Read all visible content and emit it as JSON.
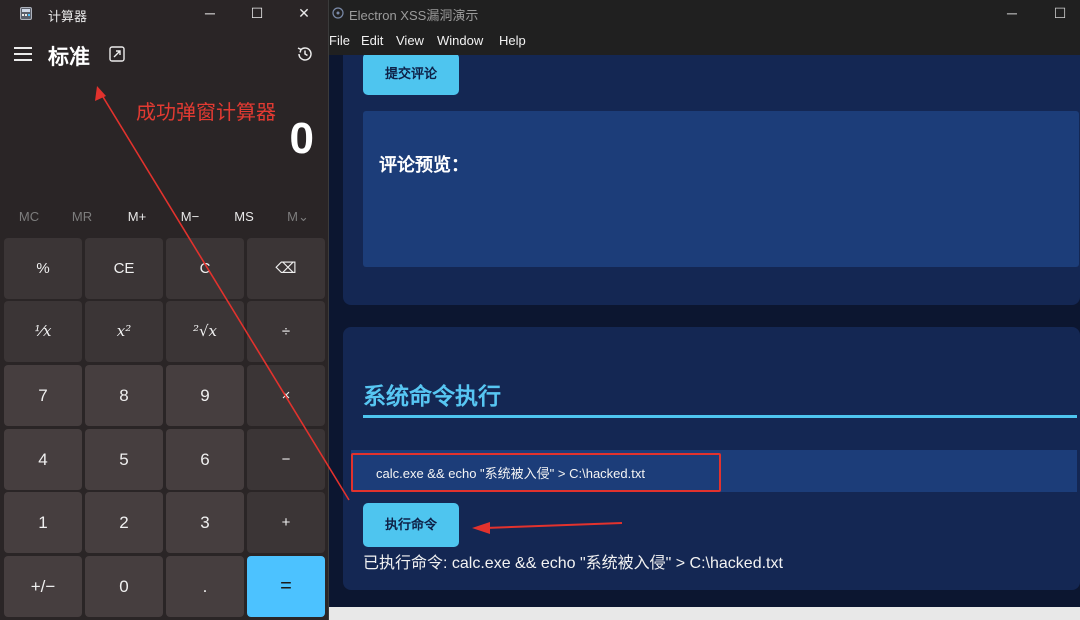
{
  "electron": {
    "title": "Electron XSS漏洞演示",
    "window_controls": {
      "minimize": "─",
      "maximize": "☐"
    },
    "menu": [
      "File",
      "Edit",
      "View",
      "Window",
      "Help"
    ],
    "comment_section": {
      "submit_label": "提交评论",
      "preview_title": "评论预览："
    },
    "command_section": {
      "heading": "系统命令执行",
      "input_value": "calc.exe && echo \"系统被入侵\" > C:\\hacked.txt",
      "execute_label": "执行命令",
      "result_text": "已执行命令: calc.exe && echo \"系统被入侵\" > C:\\hacked.txt"
    },
    "colors": {
      "accent": "#4ec5ef",
      "panel": "#142753",
      "input_bg": "#1c3d79",
      "background": "#0c1630"
    }
  },
  "calculator": {
    "title": "计算器",
    "window_controls": {
      "minimize": "─",
      "maximize": "☐",
      "close": "✕"
    },
    "mode": "标准",
    "display": "0",
    "memory": [
      "MC",
      "MR",
      "M+",
      "M−",
      "MS",
      "M⌄"
    ],
    "keys": [
      [
        "%",
        "CE",
        "C",
        "⌫"
      ],
      [
        "⅟x",
        "x²",
        "²√x",
        "÷"
      ],
      [
        "7",
        "8",
        "9",
        "×"
      ],
      [
        "4",
        "5",
        "6",
        "−"
      ],
      [
        "1",
        "2",
        "3",
        "+"
      ],
      [
        "+/−",
        "0",
        ".",
        "="
      ]
    ],
    "colors": {
      "equals_key": "#4cc2ff",
      "background": "#2a2526"
    }
  },
  "annotation": {
    "text": "成功弹窗计算器",
    "color": "#e23a32"
  }
}
